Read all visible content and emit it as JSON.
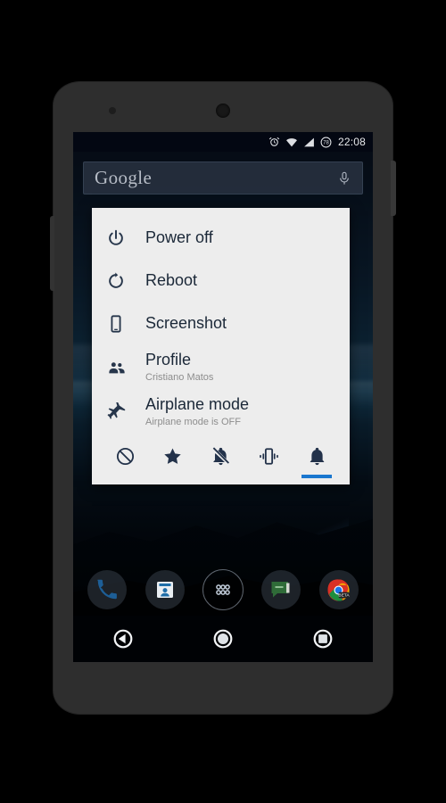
{
  "device": {
    "name": "android-phone-mockup",
    "body_color": "#2e2e2e"
  },
  "statusbar": {
    "time": "22:08",
    "battery_percent": "78",
    "icons": [
      "alarm-icon",
      "wifi-icon",
      "signal-icon",
      "battery-icon"
    ]
  },
  "search": {
    "brand": "Google",
    "mic": "microphone-icon"
  },
  "dialog": {
    "items": [
      {
        "icon": "power-icon",
        "title": "Power off",
        "subtitle": ""
      },
      {
        "icon": "reboot-icon",
        "title": "Reboot",
        "subtitle": ""
      },
      {
        "icon": "screenshot-icon",
        "title": "Screenshot",
        "subtitle": ""
      },
      {
        "icon": "profile-icon",
        "title": "Profile",
        "subtitle": "Cristiano Matos"
      },
      {
        "icon": "airplane-icon",
        "title": "Airplane mode",
        "subtitle": "Airplane mode is OFF"
      }
    ],
    "sound_modes": [
      {
        "icon": "block-icon",
        "label": "None",
        "selected": false
      },
      {
        "icon": "star-icon",
        "label": "Priority",
        "selected": false
      },
      {
        "icon": "bell-off-icon",
        "label": "Silent",
        "selected": false
      },
      {
        "icon": "vibrate-icon",
        "label": "Vibrate",
        "selected": false
      },
      {
        "icon": "bell-icon",
        "label": "Ring",
        "selected": true
      }
    ],
    "accent_color": "#1a77cf",
    "background_color": "#ededed",
    "title_color": "#1b2838",
    "subtitle_color": "#8d8d8d"
  },
  "dock": {
    "apps": [
      {
        "icon": "phone-icon",
        "label": "Phone"
      },
      {
        "icon": "contacts-icon",
        "label": "Contacts"
      },
      {
        "icon": "app-drawer-icon",
        "label": "Apps"
      },
      {
        "icon": "messaging-icon",
        "label": "Messaging"
      },
      {
        "icon": "chrome-icon",
        "label": "Chrome",
        "badge": "BETA"
      }
    ]
  },
  "navbar": {
    "buttons": [
      {
        "icon": "back-icon",
        "label": "Back"
      },
      {
        "icon": "home-icon",
        "label": "Home"
      },
      {
        "icon": "recents-icon",
        "label": "Recents"
      }
    ]
  }
}
